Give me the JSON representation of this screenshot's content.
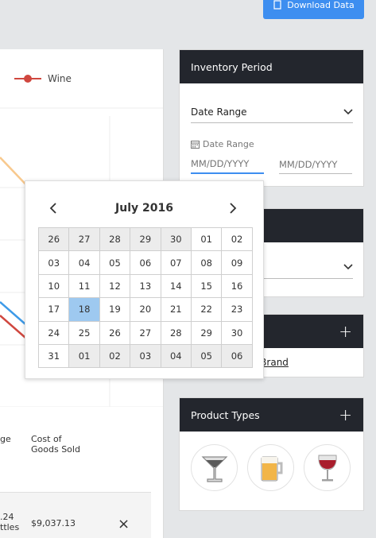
{
  "header": {
    "download_label": "Download Data"
  },
  "legend": {
    "series_name": "Wine",
    "color": "#d0473f"
  },
  "table": {
    "col_partial": "ge",
    "col_cogs_line1": "Cost of",
    "col_cogs_line2": "Goods Sold",
    "row": {
      "qty_line1": ".24",
      "qty_line2": "ttles",
      "cogs": "$9,037.13"
    },
    "remove_icon": "×"
  },
  "inventory_period": {
    "title": "Inventory Period",
    "select_value": "Date Range",
    "date_label": "Date Range",
    "start_placeholder": "MM/DD/YYYY",
    "end_placeholder": "MM/DD/YYYY"
  },
  "calendar": {
    "title": "July 2016",
    "prev": "‹",
    "next": "›",
    "weeks": [
      [
        {
          "d": "26",
          "o": true
        },
        {
          "d": "27",
          "o": true
        },
        {
          "d": "28",
          "o": true
        },
        {
          "d": "29",
          "o": true
        },
        {
          "d": "30",
          "o": true
        },
        {
          "d": "01"
        },
        {
          "d": "02"
        }
      ],
      [
        {
          "d": "03"
        },
        {
          "d": "04"
        },
        {
          "d": "05"
        },
        {
          "d": "06"
        },
        {
          "d": "07"
        },
        {
          "d": "08"
        },
        {
          "d": "09"
        }
      ],
      [
        {
          "d": "10"
        },
        {
          "d": "11"
        },
        {
          "d": "12"
        },
        {
          "d": "13"
        },
        {
          "d": "14"
        },
        {
          "d": "15"
        },
        {
          "d": "16"
        }
      ],
      [
        {
          "d": "17"
        },
        {
          "d": "18",
          "s": true
        },
        {
          "d": "19"
        },
        {
          "d": "20"
        },
        {
          "d": "21"
        },
        {
          "d": "22"
        },
        {
          "d": "23"
        }
      ],
      [
        {
          "d": "24"
        },
        {
          "d": "25"
        },
        {
          "d": "26"
        },
        {
          "d": "27"
        },
        {
          "d": "28"
        },
        {
          "d": "29"
        },
        {
          "d": "30"
        }
      ],
      [
        {
          "d": "31"
        },
        {
          "d": "01",
          "o": true
        },
        {
          "d": "02",
          "o": true
        },
        {
          "d": "03",
          "o": true
        },
        {
          "d": "04",
          "o": true
        },
        {
          "d": "05",
          "o": true
        },
        {
          "d": "06",
          "o": true
        }
      ]
    ]
  },
  "brand_panel": {
    "plus": "+",
    "link": "a Brand"
  },
  "product_types": {
    "title": "Product Types",
    "plus": "+",
    "icons": [
      "cocktail-icon",
      "beer-icon",
      "wine-icon"
    ]
  },
  "colors": {
    "accent": "#3d8ef0",
    "header_dark": "#23262d",
    "selected_day": "#9ec9f0",
    "line_orange": "#f8c98e",
    "line_blue": "#3d9ae8",
    "line_red": "#d0473f"
  }
}
